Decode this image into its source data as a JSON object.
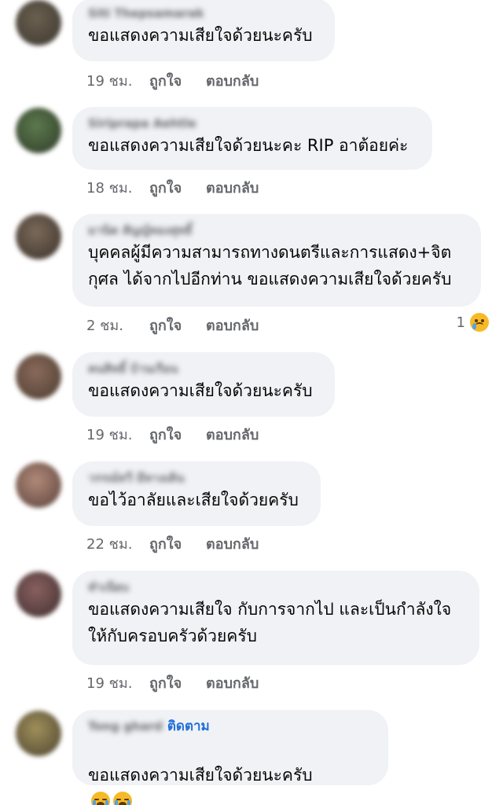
{
  "labels": {
    "like": "ถูกใจ",
    "reply": "ตอบกลับ",
    "follow": "ติดตาม"
  },
  "comments": [
    {
      "author": "Siti Thepsamarak",
      "text": "ขอแสดงความเสียใจด้วยนะครับ",
      "time": "19 ชม."
    },
    {
      "author": "Siriprapa Aehtle",
      "text": "ขอแสดงความเสียใจด้วยนะคะ RIP อาต้อยค่ะ",
      "time": "18 ชม."
    },
    {
      "author": "มานิต สัญญ์ทองสุทธิ์",
      "text": "บุคคลผู้มีความสามารถทางดนตรีและการแสดง+จิต\nกุศล ได้จากไปอีกท่าน ขอแสดงความเสียใจด้วยครับ",
      "time": "2 ชม.",
      "reaction_count": "1",
      "reaction_icon": "sad-face-icon"
    },
    {
      "author": "คนสิทธิ์ บ้านเรือน",
      "text": "ขอแสดงความเสียใจด้วยนะครับ",
      "time": "19 ชม."
    },
    {
      "author": "วรรณ์ทวี มีทางเดิน",
      "text": "ขอไว้อาลัยและเสียใจด้วยครับ",
      "time": "22 ชม."
    },
    {
      "author": "ทำเนียบ",
      "text": "ขอแสดงความเสียใจ กับการจากไป และเป็นกำลังใจ\nให้กับครอบครัวด้วยครับ",
      "time": "19 ชม."
    },
    {
      "author": "Tong ghard",
      "text": "ขอแสดงความเสียใจด้วยนะครับ",
      "follow": "ติดตาม",
      "emoji_icons": [
        "loudly-crying-face-icon",
        "loudly-crying-face-icon"
      ]
    }
  ],
  "colors": {
    "bubble": "#f0f2f5",
    "meta_text": "#65676b",
    "follow_link": "#216fdb"
  }
}
